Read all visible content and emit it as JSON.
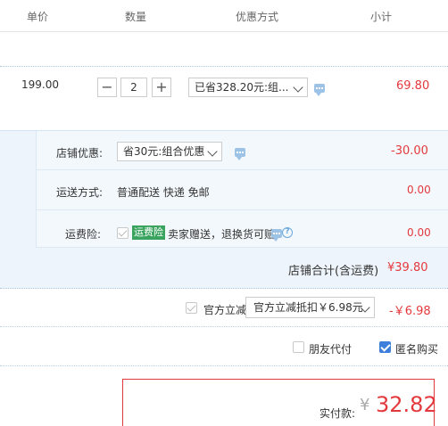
{
  "header": {
    "col_price": "单价",
    "col_qty": "数量",
    "col_discount": "优惠方式",
    "col_subtotal": "小计"
  },
  "item": {
    "unit_price": "199.00",
    "qty_minus": "−",
    "quantity": "2",
    "qty_plus": "+",
    "discount_select": "已省328.20元:组...",
    "subtotal": "69.80"
  },
  "shop": {
    "promo_label": "店铺优惠:",
    "promo_select": "省30元:组合优惠",
    "promo_amount": "-30.00",
    "shipping_label": "运送方式:",
    "shipping_value": "普通配送 快递 免邮",
    "shipping_amount": "0.00",
    "insurance_label": "运费险:",
    "insurance_badge": "运费险",
    "insurance_text": "卖家赠送，退换货可赔",
    "insurance_amount": "0.00",
    "total_label": "店铺合计(含运费)",
    "total_value": "¥39.80"
  },
  "official": {
    "label": "官方立减",
    "select": "官方立减抵扣￥6.98元",
    "amount": "-￥6.98"
  },
  "options": {
    "friend_pay": "朋友代付",
    "anonymous": "匿名购买"
  },
  "payment": {
    "label": "实付款:",
    "currency": "¥",
    "amount": "32.82"
  },
  "colors": {
    "price_red": "#e4393c",
    "accent_blue": "#3d7fdb",
    "badge_green": "#3aa45f"
  }
}
